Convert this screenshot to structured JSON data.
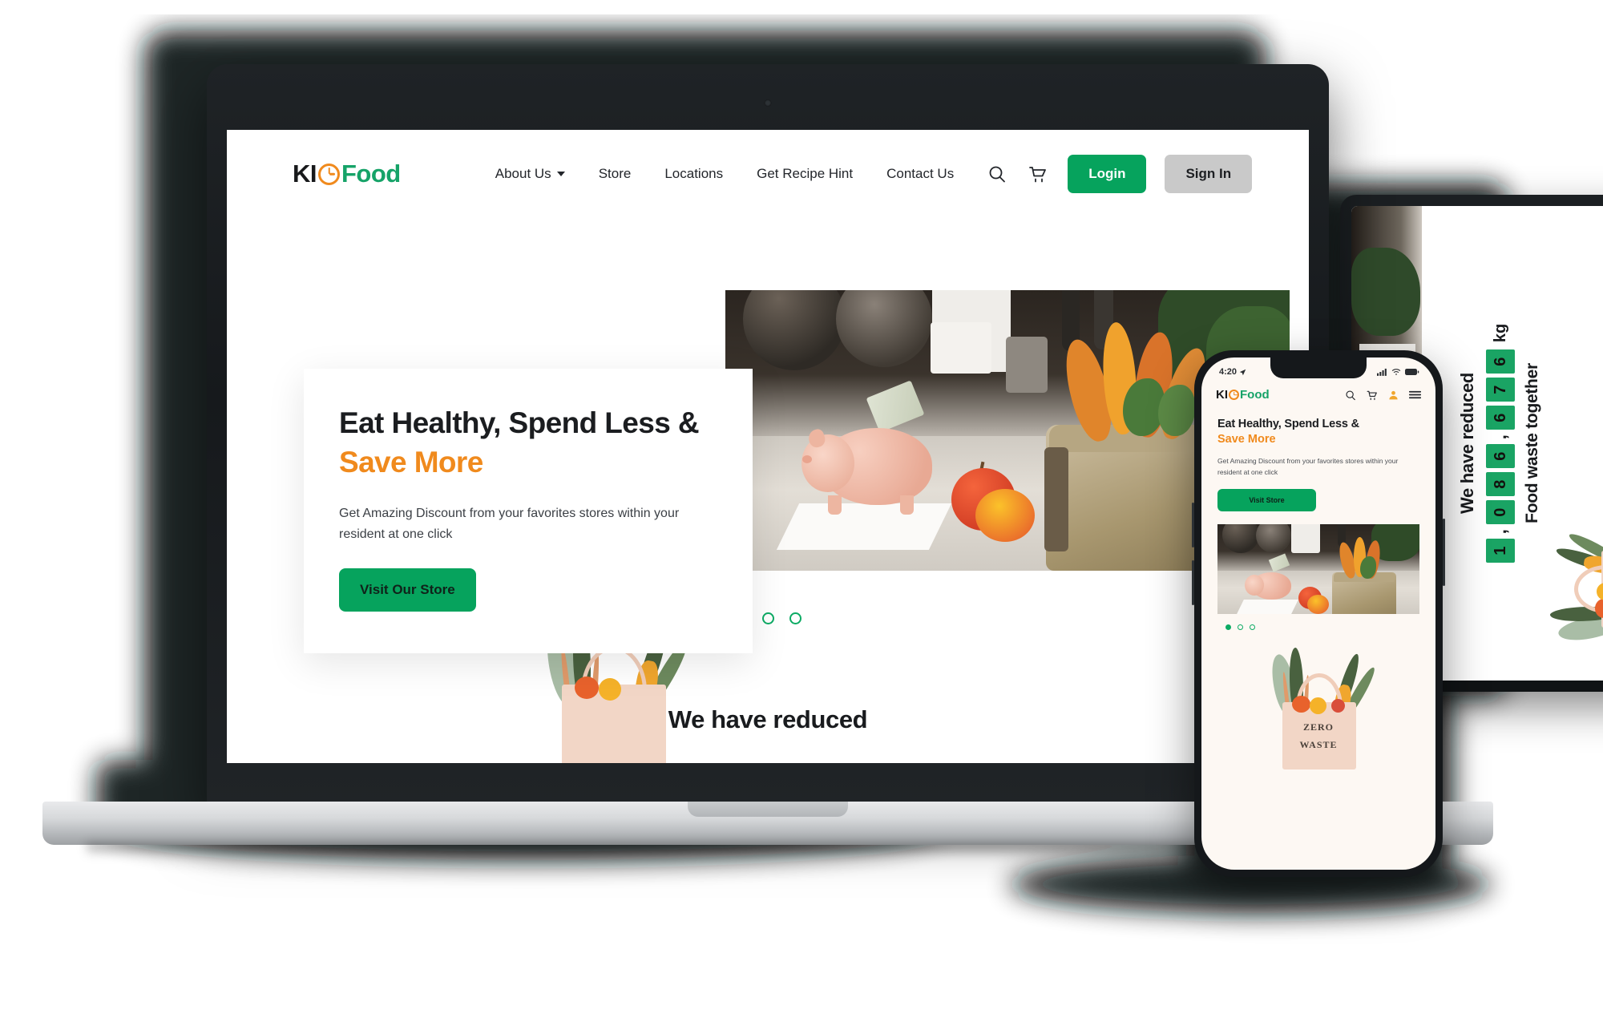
{
  "brand": {
    "name_part1": "KI",
    "name_part2": "Food",
    "logo_icon": "clock-icon",
    "accent_green": "#06a35d",
    "accent_orange": "#f08a1d",
    "dark": "#18191b"
  },
  "desktop": {
    "nav": {
      "links": [
        {
          "label": "About Us",
          "has_dropdown": true
        },
        {
          "label": "Store",
          "has_dropdown": false
        },
        {
          "label": "Locations",
          "has_dropdown": false
        },
        {
          "label": "Get Recipe Hint",
          "has_dropdown": false
        },
        {
          "label": "Contact Us",
          "has_dropdown": false
        }
      ],
      "icons": [
        {
          "name": "search-icon"
        },
        {
          "name": "cart-icon"
        }
      ],
      "login_label": "Login",
      "signin_label": "Sign In"
    },
    "hero": {
      "heading_line1": "Eat Healthy, Spend Less &",
      "heading_line2": "Save More",
      "paragraph": "Get Amazing Discount from your favorites stores within your resident at one click",
      "cta_label": "Visit Our Store",
      "image_alt": "piggy-bank-apples-grocery-bag-kitchen",
      "carousel": {
        "total": 3,
        "active": 1
      }
    },
    "section_reduced": {
      "title": "We have reduced"
    }
  },
  "mobile": {
    "status_bar": {
      "time": "4:20",
      "location_icon": "location-arrow-icon",
      "signal_icon": "cellular-icon",
      "wifi_icon": "wifi-icon",
      "battery_icon": "battery-icon"
    },
    "nav": {
      "icons": [
        {
          "name": "search-icon"
        },
        {
          "name": "cart-icon"
        },
        {
          "name": "user-icon"
        },
        {
          "name": "hamburger-menu-icon"
        }
      ]
    },
    "hero": {
      "heading_line1": "Eat Healthy, Spend Less &",
      "heading_line2": "Save More",
      "paragraph": "Get Amazing Discount from your favorites stores within your resident at one click",
      "cta_label": "Visit Store",
      "carousel": {
        "total": 3,
        "active": 1
      }
    },
    "illustration": {
      "bag_text_line1": "ZERO",
      "bag_text_line2": "WASTE"
    }
  },
  "tablet": {
    "counter": {
      "title": "We have reduced",
      "digits": [
        "1",
        "0",
        "8",
        "6",
        "6",
        "7",
        "6"
      ],
      "separators": {
        "after_index_0": ",",
        "after_index_3": ","
      },
      "unit": "kg",
      "subtitle": "Food waste together",
      "digit_bg": "#1aa464"
    }
  }
}
